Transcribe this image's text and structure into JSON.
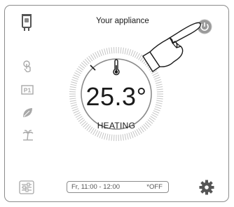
{
  "header": {
    "title": "Your appliance"
  },
  "thermostat": {
    "temperature": "25.3°",
    "mode": "HEATING"
  },
  "schedule": {
    "slot": "Fr, 11:00 - 12:00",
    "state": "*OFF"
  },
  "sidebar": {
    "items": [
      {
        "icon": "touch-control-icon"
      },
      {
        "icon": "p1-program-icon",
        "label": "P1"
      },
      {
        "icon": "eco-leaf-icon"
      },
      {
        "icon": "holiday-palm-icon"
      }
    ]
  },
  "icons": {
    "appliance": "boiler-icon",
    "power": "power-button-icon",
    "thermometer": "thermometer-icon",
    "settings": "gear-icon",
    "adjust": "sliders-icon",
    "pointer": "pointing-hand-icon"
  },
  "colors": {
    "icon_grey": "#a8a8a8",
    "text_dark": "#1a1a1a",
    "border": "#8c8c8c",
    "gear": "#555555"
  }
}
